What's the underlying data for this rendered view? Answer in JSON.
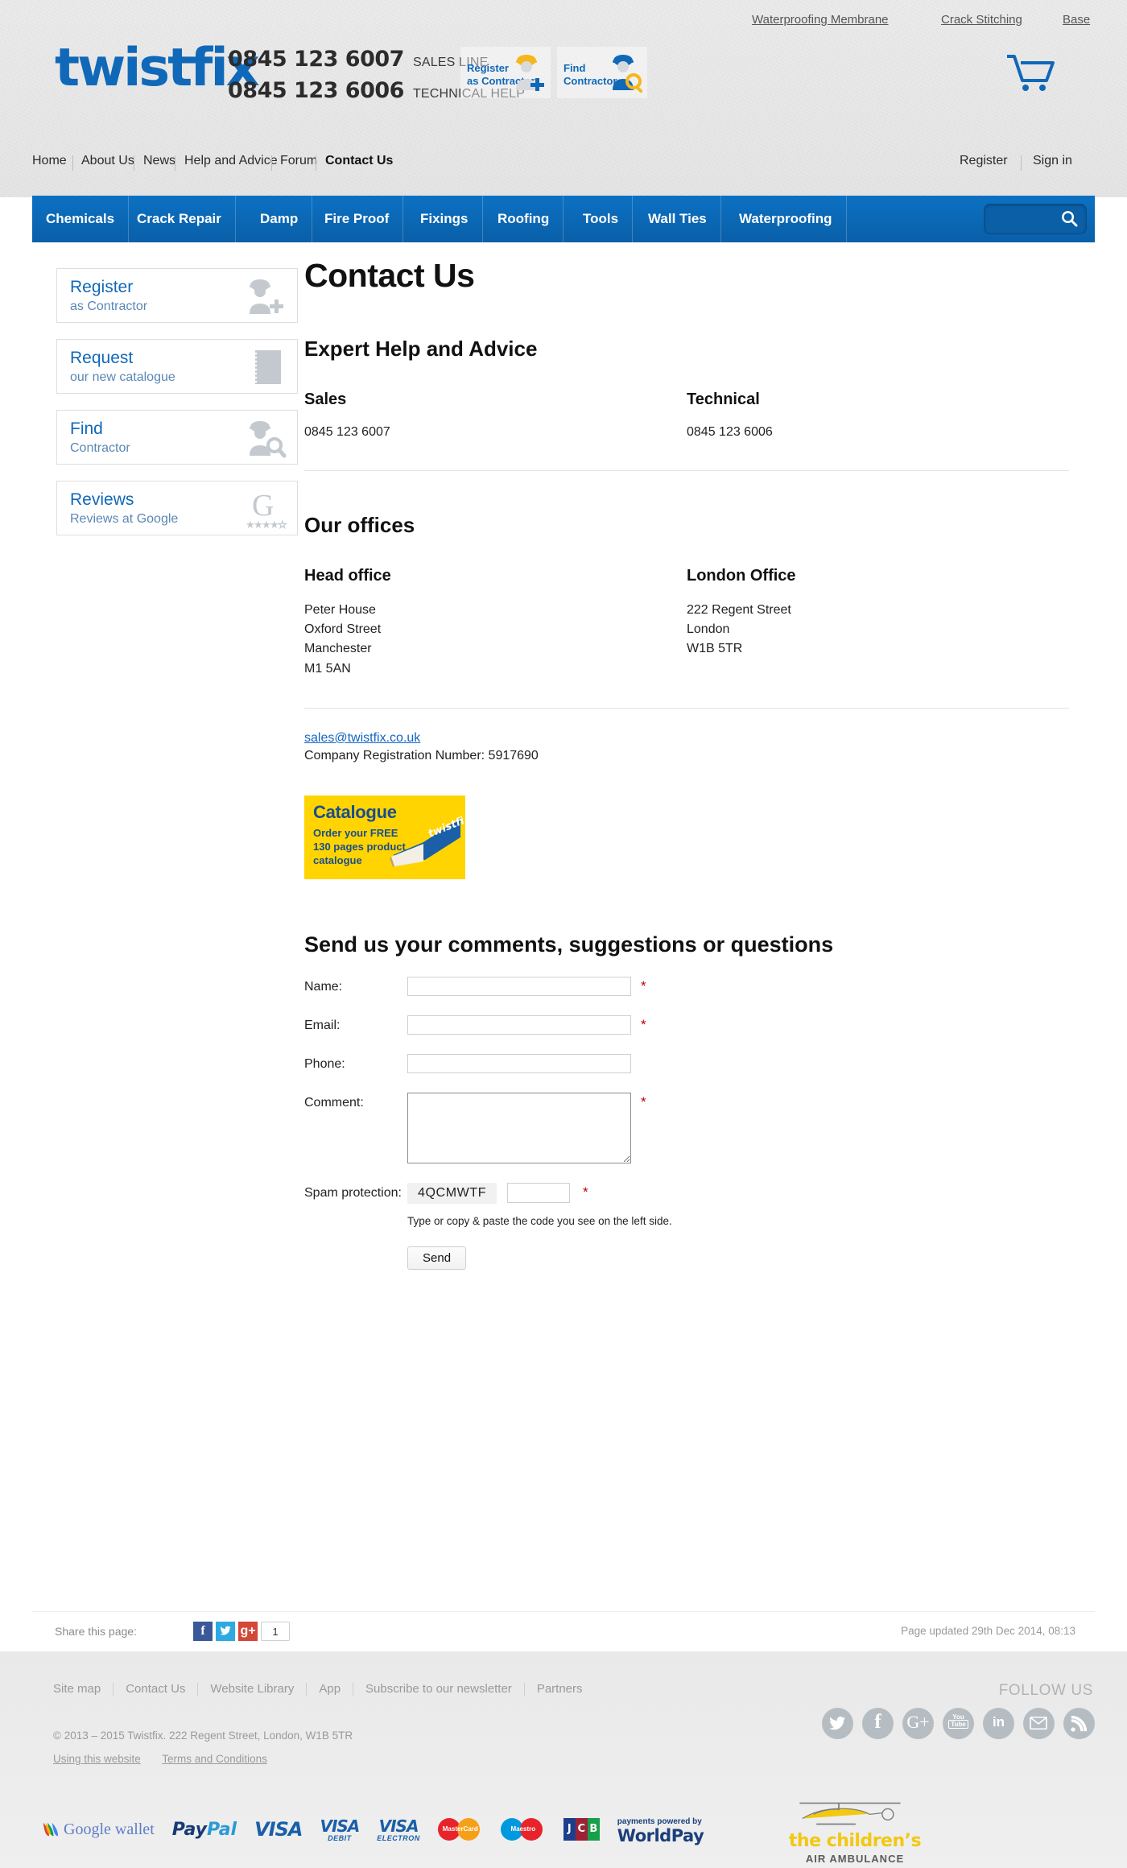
{
  "header": {
    "top_links": [
      "Waterproofing Membrane",
      "Crack Stitching",
      "Base"
    ],
    "logo": "twistfix",
    "phones": [
      {
        "number": "0845 123 6007",
        "label": "SALES LINE"
      },
      {
        "number": "0845 123 6006",
        "label": "TECHNICAL HELP"
      }
    ],
    "cta": [
      {
        "line1": "Register",
        "line2": "as Contractor",
        "icon": "contractor-add-icon"
      },
      {
        "line1": "Find",
        "line2": "Contractor",
        "icon": "contractor-search-icon"
      }
    ],
    "cart_icon": "shopping-cart-icon"
  },
  "mainnav": {
    "items": [
      "Home",
      "About Us",
      "News",
      "Help and Advice",
      "Forum",
      "Contact Us"
    ],
    "active": "Contact Us",
    "account": [
      "Register",
      "Sign in"
    ]
  },
  "categories": {
    "items": [
      "Chemicals",
      "Crack Repair",
      "Damp",
      "Fire Proof",
      "Fixings",
      "Roofing",
      "Tools",
      "Wall Ties",
      "Waterproofing"
    ],
    "search_placeholder": "",
    "search_value": "",
    "search_icon": "search-icon"
  },
  "sidebar": {
    "cards": [
      {
        "title": "Register",
        "subtitle": "as Contractor",
        "icon": "contractor-add-icon"
      },
      {
        "title": "Request",
        "subtitle": "our new catalogue",
        "icon": "catalogue-book-icon"
      },
      {
        "title": "Find",
        "subtitle": "Contractor",
        "icon": "contractor-search-icon"
      },
      {
        "title": "Reviews",
        "subtitle": "Reviews at Google",
        "icon": "google-reviews-icon"
      }
    ]
  },
  "main": {
    "page_title": "Contact Us",
    "expert_heading": "Expert Help and Advice",
    "contacts": [
      {
        "heading": "Sales",
        "phone": "0845 123 6007"
      },
      {
        "heading": "Technical",
        "phone": "0845 123 6006"
      }
    ],
    "offices_heading": "Our offices",
    "offices": [
      {
        "heading": "Head office",
        "lines": [
          "Peter House",
          "Oxford Street",
          "Manchester",
          "M1 5AN"
        ]
      },
      {
        "heading": "London Office",
        "lines": [
          "222 Regent Street",
          "London",
          "W1B 5TR"
        ]
      }
    ],
    "email": "sales@twistfix.co.uk",
    "company_reg": "Company Registration Number: 5917690",
    "catalogue": {
      "title": "Catalogue",
      "subtitle": "Order your FREE 130 pages product catalogue",
      "book_label": "twistfix"
    }
  },
  "form": {
    "title": "Send us your comments, suggestions or questions",
    "fields": [
      {
        "label": "Name:",
        "value": "",
        "placeholder": "",
        "required": "*",
        "type": "text"
      },
      {
        "label": "Email:",
        "value": "",
        "placeholder": "",
        "required": "*",
        "type": "text"
      },
      {
        "label": "Phone:",
        "value": "",
        "placeholder": "",
        "required": "",
        "type": "text"
      },
      {
        "label": "Comment:",
        "value": "",
        "placeholder": "",
        "required": "*",
        "type": "textarea"
      }
    ],
    "spam_label": "Spam protection:",
    "captcha_code": "4QCMWTF",
    "captcha_value": "",
    "captcha_required": "*",
    "captcha_hint": "Type or copy & paste the code you see on the left side.",
    "send_label": "Send"
  },
  "share": {
    "label": "Share this page:",
    "buttons": [
      "f",
      "t",
      "g+"
    ],
    "count": "1",
    "updated": "Page updated 29th Dec 2014, 08:13"
  },
  "footer": {
    "links": [
      "Site map",
      "Contact Us",
      "Website Library",
      "App",
      "Subscribe to our newsletter",
      "Partners"
    ],
    "copyright": "© 2013 – 2015 Twistfix. 222 Regent Street, London, W1B 5TR",
    "legal": [
      "Using this website",
      "Terms and Conditions"
    ],
    "follow_label": "FOLLOW US",
    "socials": [
      "twitter-icon",
      "facebook-icon",
      "google-plus-icon",
      "youtube-icon",
      "linkedin-icon",
      "email-icon",
      "rss-icon"
    ],
    "payments": [
      "Google wallet",
      "PayPal",
      "VISA",
      "VISA DEBIT",
      "VISA ELECTRON",
      "MasterCard",
      "Maestro",
      "JCB",
      "payments powered by WorldPay"
    ],
    "payment_parts": {
      "google_wallet": "Google wallet",
      "paypal_a": "Pay",
      "paypal_b": "Pal",
      "visa": "VISA",
      "visa_debit": "DEBIT",
      "visa_electron": "ELECTRON",
      "mastercard": "MasterCard",
      "maestro": "Maestro",
      "jcb_j": "J",
      "jcb_c": "C",
      "jcb_b": "B",
      "worldpay_small": "payments powered by",
      "worldpay_big": "WorldPay"
    },
    "charity": {
      "line1": "the children’s",
      "line2": "AIR AMBULANCE",
      "icon": "helicopter-icon"
    }
  },
  "colors": {
    "brand_blue": "#1068b8",
    "nav_blue": "#0c71c3",
    "yellow": "#ffd400",
    "required_red": "#c00000",
    "link_blue": "#1165c0"
  }
}
